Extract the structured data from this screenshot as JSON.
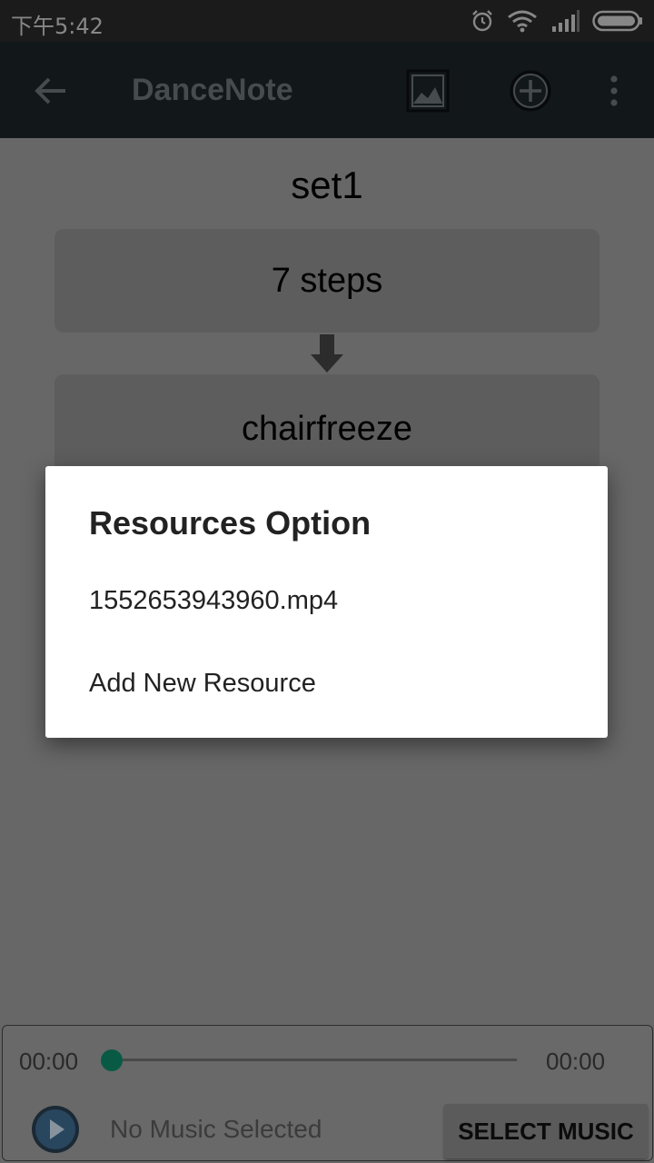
{
  "status_bar": {
    "time": "下午5:42",
    "icons": [
      "alarm-icon",
      "wifi-icon",
      "signal-icon",
      "battery-icon"
    ]
  },
  "app_bar": {
    "title": "DanceNote",
    "icons": [
      "back-arrow-icon",
      "image-icon",
      "add-circle-icon",
      "more-vert-icon"
    ],
    "background": "#1d2428"
  },
  "main": {
    "set_title": "set1",
    "steps": [
      {
        "label": "7 steps"
      },
      {
        "label": "chairfreeze"
      }
    ]
  },
  "player": {
    "time_start": "00:00",
    "time_end": "00:00",
    "progress": 0,
    "status": "No Music Selected",
    "select_button": "SELECT MUSIC",
    "accent": "#0e8a6b"
  },
  "dialog": {
    "title": "Resources Option",
    "items": [
      {
        "label": "1552653943960.mp4"
      },
      {
        "label": "Add New Resource"
      }
    ]
  }
}
